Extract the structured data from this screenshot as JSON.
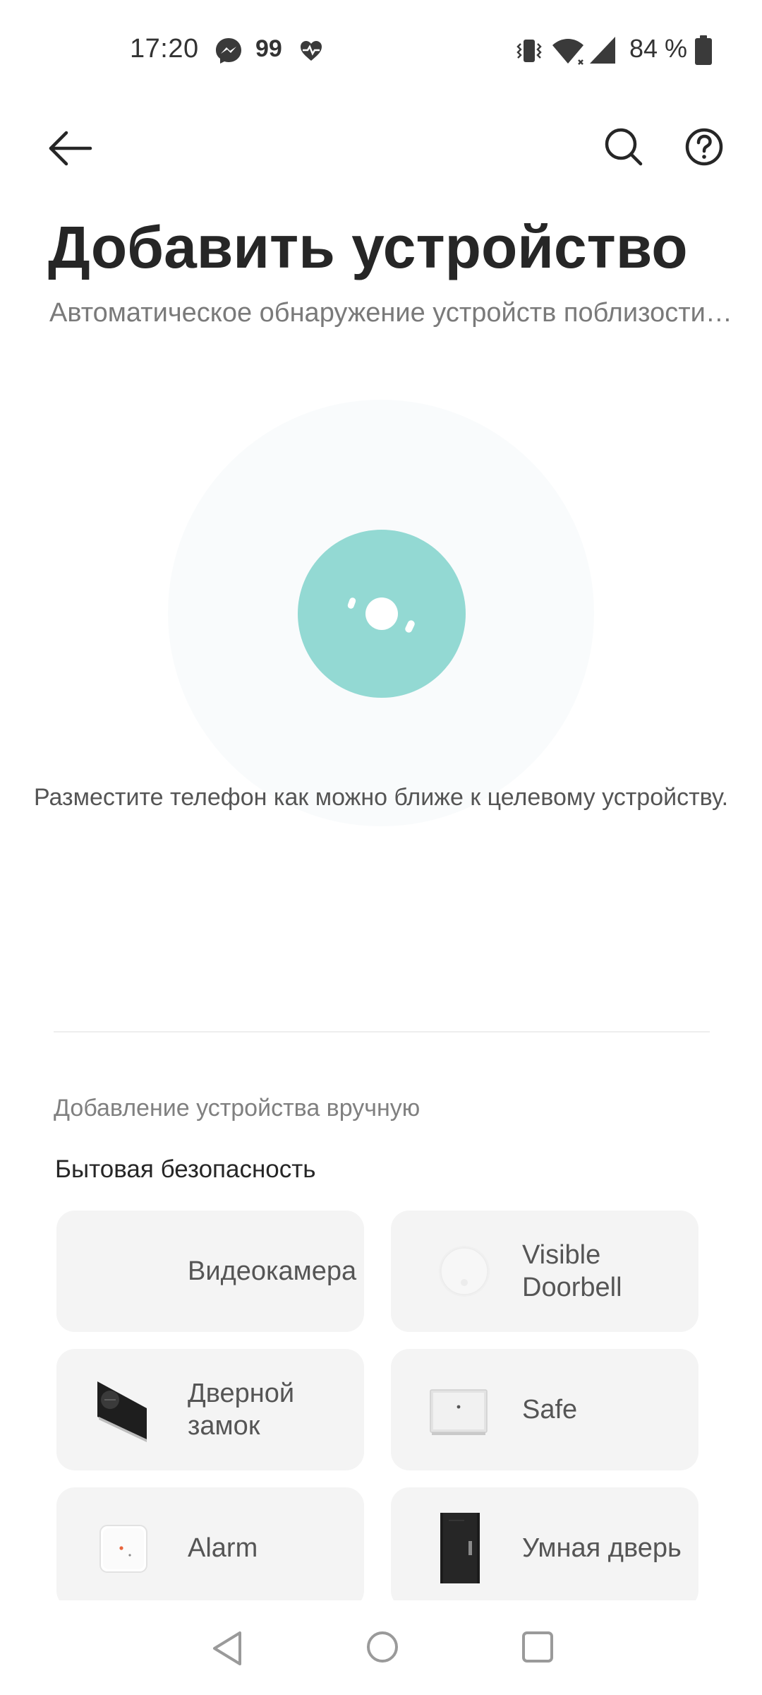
{
  "status_bar": {
    "time": "17:20",
    "notification_count": "99",
    "battery_text": "84 %",
    "icons": [
      "messenger-icon",
      "heart-rate-icon",
      "vibrate-icon",
      "wifi-icon",
      "signal-icon",
      "battery-icon"
    ]
  },
  "header": {
    "title": "Добавить устройство",
    "subtitle": "Автоматическое обнаружение устройств поблизости…",
    "icons": [
      "back-arrow-icon",
      "search-icon",
      "help-icon"
    ]
  },
  "scan": {
    "hint": "Разместите телефон как можно ближе к целевому устройству.",
    "colors": {
      "accent": "#93d9d3",
      "halo": "#f9fbfc"
    }
  },
  "manual": {
    "title": "Добавление устройства вручную",
    "category": "Бытовая безопасность",
    "devices": [
      {
        "label": "Видеокамера",
        "icon": "camera-device"
      },
      {
        "label": "Visible Doorbell",
        "icon": "doorbell-device"
      },
      {
        "label": "Дверной замок",
        "icon": "door-lock-device"
      },
      {
        "label": "Safe",
        "icon": "safe-device"
      },
      {
        "label": "Alarm",
        "icon": "alarm-device"
      },
      {
        "label": "Умная дверь",
        "icon": "smart-door-device"
      }
    ]
  },
  "nav": {
    "icons": [
      "nav-back-icon",
      "nav-home-icon",
      "nav-recents-icon"
    ]
  }
}
